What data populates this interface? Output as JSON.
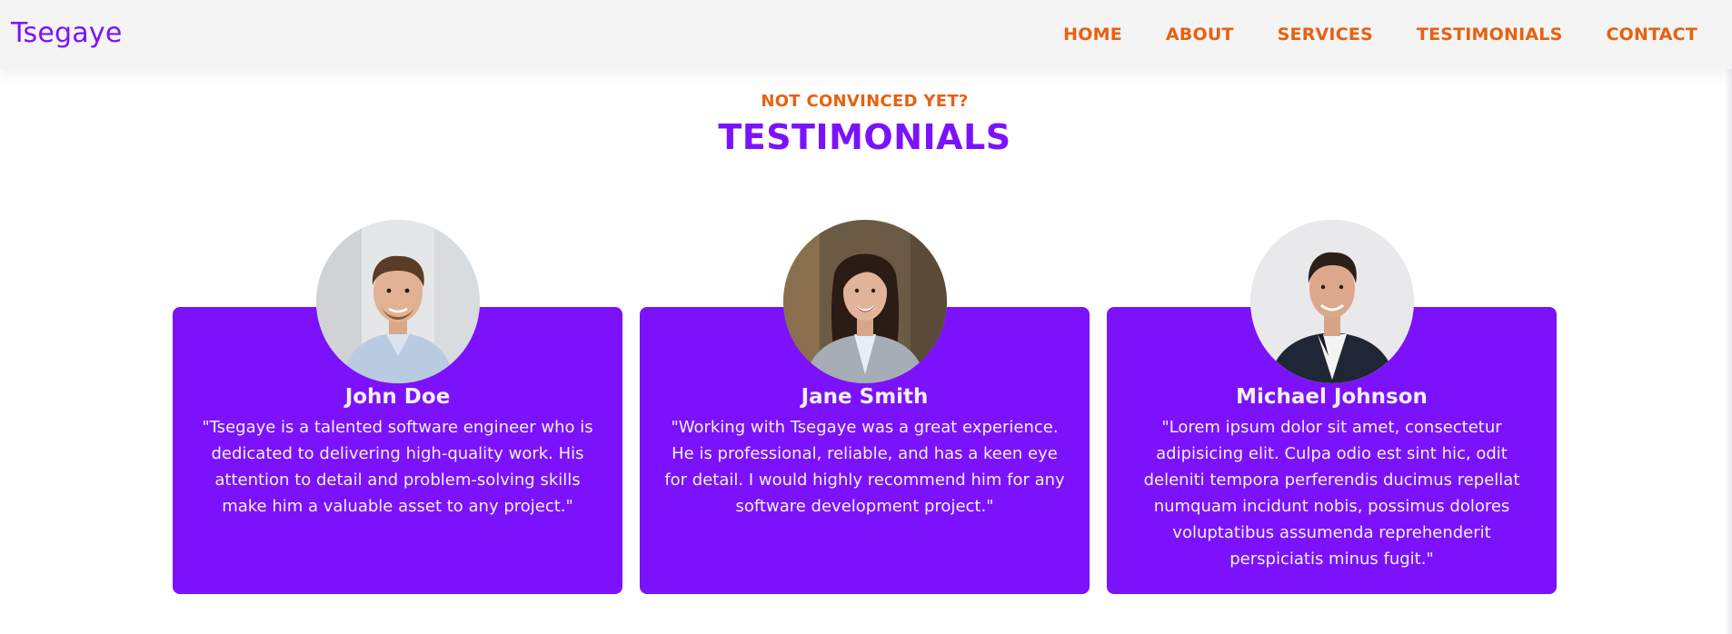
{
  "nav": {
    "brand": "Tsegaye",
    "links": [
      "HOME",
      "ABOUT",
      "SERVICES",
      "TESTIMONIALS",
      "CONTACT"
    ]
  },
  "section": {
    "subtitle": "NOT CONVINCED YET?",
    "title": "TESTIMONIALS"
  },
  "testimonials": [
    {
      "name": "John Doe",
      "quote": "\"Tsegaye is a talented software engineer who is dedicated to delivering high-quality work. His attention to detail and problem-solving skills make him a valuable asset to any project.\""
    },
    {
      "name": "Jane Smith",
      "quote": "\"Working with Tsegaye was a great experience. He is professional, reliable, and has a keen eye for detail. I would highly recommend him for any software development project.\""
    },
    {
      "name": "Michael Johnson",
      "quote": "\"Lorem ipsum dolor sit amet, consectetur adipisicing elit. Culpa odio est sint hic, odit deleniti tempora perferendis ducimus repellat numquam incidunt nobis, possimus dolores voluptatibus assumenda reprehenderit perspiciatis minus fugit.\""
    }
  ],
  "colors": {
    "brand_purple": "#7b12fb",
    "accent_orange": "#e8600f",
    "navbar_bg": "#f4f4f4",
    "card_text": "#f1f1f1"
  }
}
